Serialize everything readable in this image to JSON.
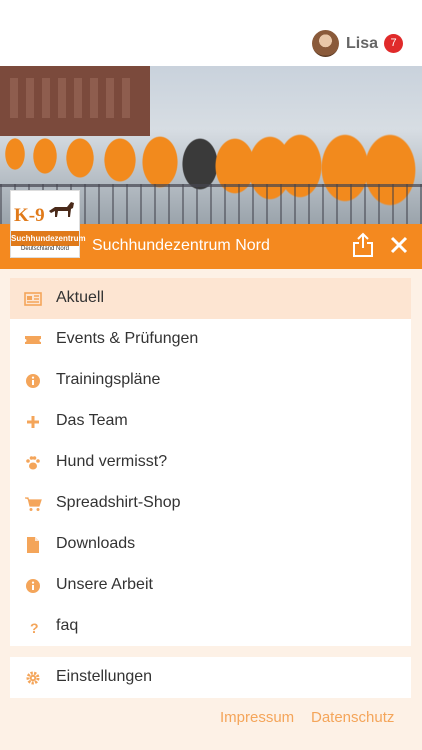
{
  "header": {
    "user_name": "Lisa",
    "notification_count": "7"
  },
  "hero": {
    "logo_text": "K-9",
    "logo_band": "Suchhundezentrum",
    "logo_sub": "Deutschland Nord",
    "title": "Suchhundezentrum Nord"
  },
  "menu": {
    "items": [
      {
        "label": "Aktuell",
        "icon": "newspaper-icon"
      },
      {
        "label": "Events & Prüfungen",
        "icon": "ticket-icon"
      },
      {
        "label": "Trainingspläne",
        "icon": "info-icon"
      },
      {
        "label": "Das Team",
        "icon": "plus-icon"
      },
      {
        "label": "Hund vermisst?",
        "icon": "paw-icon"
      },
      {
        "label": "Spreadshirt-Shop",
        "icon": "cart-icon"
      },
      {
        "label": "Downloads",
        "icon": "file-icon"
      },
      {
        "label": "Unsere Arbeit",
        "icon": "info-icon"
      },
      {
        "label": "faq",
        "icon": "question-icon"
      }
    ],
    "settings_label": "Einstellungen"
  },
  "footer": {
    "impressum": "Impressum",
    "datenschutz": "Datenschutz"
  },
  "colors": {
    "accent": "#f4891f",
    "active_bg": "#fde5d2",
    "badge": "#e02a2a",
    "page_bg": "#fdf1e6"
  }
}
